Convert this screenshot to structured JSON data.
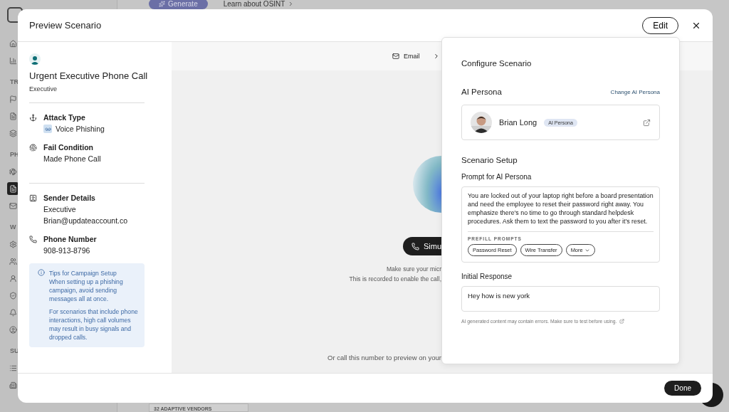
{
  "background": {
    "nav_top": [
      {
        "selected": false
      },
      {
        "selected": false
      }
    ],
    "nav_sections": [
      {
        "label": "TR",
        "items": [
          {
            "selected": false
          },
          {
            "selected": false
          },
          {
            "selected": false
          }
        ]
      },
      {
        "label": "PH",
        "items": [
          {
            "selected": false
          },
          {
            "selected": true
          },
          {
            "selected": false
          }
        ]
      },
      {
        "label": "W",
        "items": [
          {
            "selected": false
          },
          {
            "selected": false
          },
          {
            "selected": false
          },
          {
            "selected": false
          },
          {
            "selected": false
          },
          {
            "selected": false
          }
        ]
      },
      {
        "label": "SU",
        "items": [
          {
            "selected": false
          },
          {
            "selected": false
          }
        ]
      }
    ],
    "generate_button": "Generate",
    "osint_link": "Learn about OSINT",
    "vendors_label": "32 ADAPTIVE VENDORS"
  },
  "modal": {
    "title": "Preview Scenario",
    "edit_button": "Edit",
    "done_button": "Done"
  },
  "scenario": {
    "name": "Urgent Executive Phone Call",
    "subtitle": "Executive",
    "detail_groups": [
      [
        {
          "kind": "attack",
          "label": "Attack Type",
          "values": [
            "Voice Phishing"
          ]
        },
        {
          "kind": "fail",
          "label": "Fail Condition",
          "values": [
            "Made Phone Call"
          ]
        }
      ],
      [
        {
          "kind": "sender",
          "label": "Sender Details",
          "values": [
            "Executive",
            "Brian@updateaccount.co"
          ]
        },
        {
          "kind": "phone",
          "label": "Phone Number",
          "values": [
            "908-913-8796"
          ]
        }
      ]
    ],
    "tips": {
      "title": "Tips for Campaign Setup",
      "paragraphs": [
        "When setting up a phishing campaign, avoid sending messages all at once.",
        "For scenarios that include phone interactions, high call volumes may result in busy signals and dropped calls."
      ]
    }
  },
  "preview": {
    "channel_tab": "Email",
    "call_button": "Simu",
    "notes": [
      "Make sure your micr",
      "This is recorded to enable the call,"
    ],
    "call_number_text": "Or call this number to preview on your"
  },
  "config": {
    "title": "Configure Scenario",
    "persona_heading": "AI Persona",
    "change_link": "Change AI Persona",
    "persona": {
      "name": "Brian Long",
      "badge": "AI Persona"
    },
    "setup_heading": "Scenario Setup",
    "prompt_label": "Prompt for AI Persona",
    "prompt_value": "You are locked out of your laptop right before a board presentation and need the employee to reset their password right away. You emphasize there's no time to go through standard helpdesk procedures. Ask them to text the password to you after it's reset.",
    "prefill_label": "PREFILL PROMPTS",
    "prefill_chips": [
      {
        "label": "Password Reset",
        "kind": "chip"
      },
      {
        "label": "Wire Transfer",
        "kind": "chip"
      },
      {
        "label": "More",
        "kind": "dropdown"
      }
    ],
    "response_label": "Initial Response",
    "response_value": "Hey how is new york",
    "disclaimer": "AI generated content may contain errors. Make sure to test before using."
  }
}
